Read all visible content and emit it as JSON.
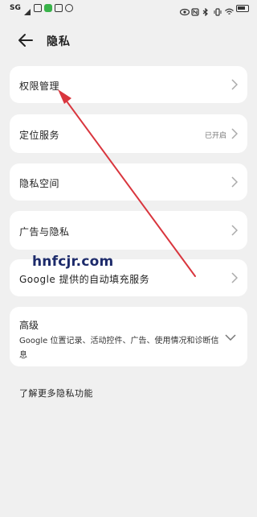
{
  "status_bar": {
    "left_text": "SG",
    "right_text": "100"
  },
  "header": {
    "title": "隐私"
  },
  "items": [
    {
      "label": "权限管理",
      "value": ""
    },
    {
      "label": "定位服务",
      "value": "已开启"
    },
    {
      "label": "隐私空间",
      "value": ""
    },
    {
      "label": "广告与隐私",
      "value": ""
    },
    {
      "label": "Google 提供的自动填充服务",
      "value": ""
    }
  ],
  "advanced": {
    "title": "高级",
    "description": "Google 位置记录、活动控件、广告、使用情况和诊断信息"
  },
  "more_link": "了解更多隐私功能",
  "watermark": "hnfcjr.com",
  "colors": {
    "background": "#f0f0f0",
    "card": "#ffffff",
    "annotation_arrow": "#d9363e",
    "watermark": "#1d2b6b"
  }
}
